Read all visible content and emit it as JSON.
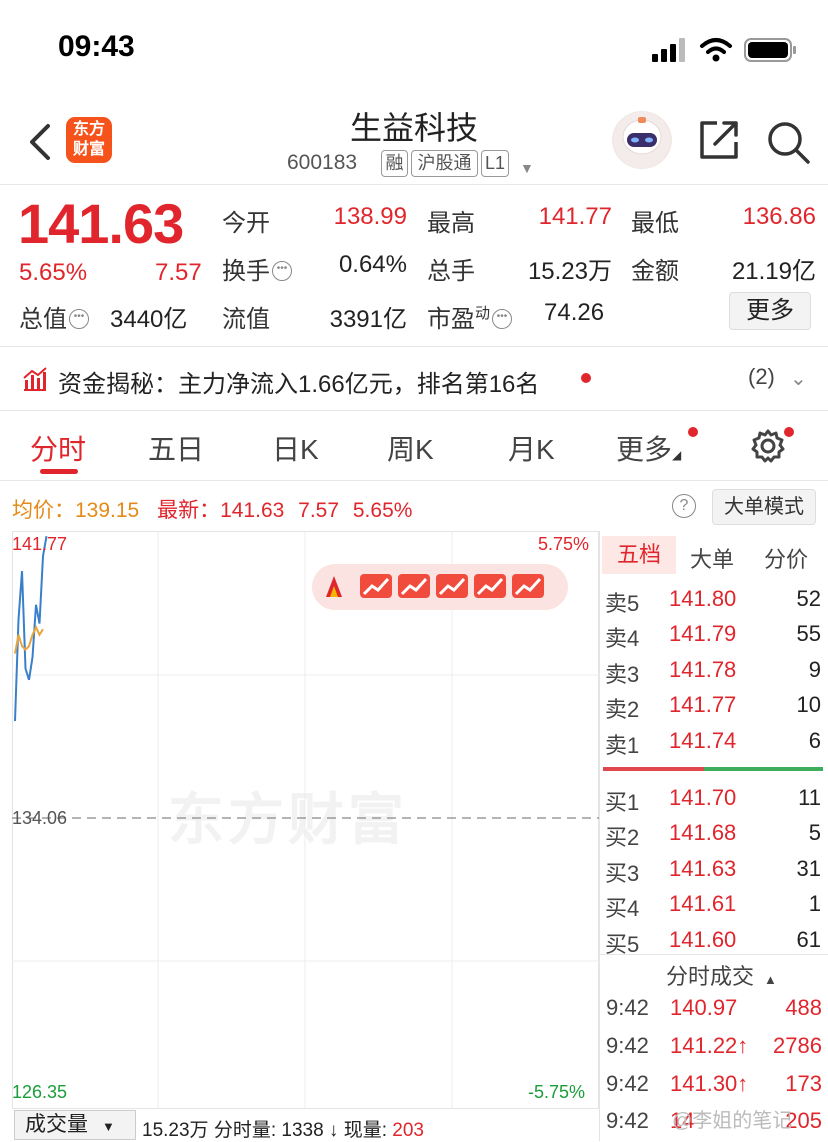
{
  "status_bar": {
    "time": "09:43"
  },
  "header": {
    "brand_line1": "东方",
    "brand_line2": "财富",
    "stock_name": "生益科技",
    "stock_code": "600183",
    "tags": [
      "融",
      "沪股通",
      "L1"
    ]
  },
  "quote": {
    "price": "141.63",
    "change_pct": "5.65%",
    "change_abs": "7.57",
    "market_cap_label": "总值",
    "market_cap": "3440亿",
    "fields": [
      {
        "label": "今开",
        "value": "138.99",
        "color": "red"
      },
      {
        "label": "最高",
        "value": "141.77",
        "color": "red"
      },
      {
        "label": "最低",
        "value": "136.86",
        "color": "red"
      },
      {
        "label": "换手",
        "value": "0.64%",
        "color": "dark"
      },
      {
        "label": "总手",
        "value": "15.23万",
        "color": "dark"
      },
      {
        "label": "金额",
        "value": "21.19亿",
        "color": "dark"
      },
      {
        "label": "流值",
        "value": "3391亿",
        "color": "dark"
      },
      {
        "label": "市盈",
        "sup": "动",
        "value": "74.26",
        "color": "dark"
      }
    ],
    "more_button": "更多"
  },
  "fund_flow": {
    "text": "资金揭秘：主力净流入1.66亿元，排名第16名",
    "count": "(2)"
  },
  "tabs": [
    "分时",
    "五日",
    "日K",
    "周K",
    "月K",
    "更多"
  ],
  "chart_header": {
    "avg_label": "均价：",
    "avg_value": "139.15",
    "latest_label": "最新：",
    "latest_price": "141.63",
    "latest_change": "7.57",
    "latest_pct": "5.65%",
    "mode_button": "大单模式"
  },
  "chart_labels": {
    "top_price": "141.77",
    "mid_price": "134.06",
    "bottom_price": "126.35",
    "top_pct": "5.75%",
    "bottom_pct": "-5.75%",
    "watermark": "东方财富"
  },
  "chart_data": {
    "type": "line",
    "title": "",
    "ylim": [
      126.35,
      141.77
    ],
    "prev_close": 134.06,
    "series": [
      {
        "values": [
          136.7,
          139.4,
          140.7,
          138.1,
          137.8,
          138.4,
          139.8,
          139.3,
          141.1,
          141.63
        ]
      },
      {
        "values": [
          138.5,
          139.0,
          138.7,
          138.6,
          138.7,
          139.0,
          139.2,
          139.0,
          139.15
        ]
      }
    ],
    "grid": true
  },
  "order_book": {
    "tabs": [
      "五档",
      "大单",
      "分价"
    ],
    "asks": [
      {
        "label": "卖5",
        "price": "141.80",
        "vol": "52"
      },
      {
        "label": "卖4",
        "price": "141.79",
        "vol": "55"
      },
      {
        "label": "卖3",
        "price": "141.78",
        "vol": "9"
      },
      {
        "label": "卖2",
        "price": "141.77",
        "vol": "10"
      },
      {
        "label": "卖1",
        "price": "141.74",
        "vol": "6"
      }
    ],
    "bids": [
      {
        "label": "买1",
        "price": "141.70",
        "vol": "11"
      },
      {
        "label": "买2",
        "price": "141.68",
        "vol": "5"
      },
      {
        "label": "买3",
        "price": "141.63",
        "vol": "31"
      },
      {
        "label": "买4",
        "price": "141.61",
        "vol": "1"
      },
      {
        "label": "买5",
        "price": "141.60",
        "vol": "61"
      }
    ],
    "ticks_title": "分时成交",
    "ticks": [
      {
        "time": "9:42",
        "price": "140.97",
        "vol": "488"
      },
      {
        "time": "9:42",
        "price": "141.22↑",
        "vol": "2786"
      },
      {
        "time": "9:42",
        "price": "141.30↑",
        "vol": "173"
      },
      {
        "time": "9:42",
        "price": "14",
        "vol": "205"
      }
    ]
  },
  "bottom": {
    "volume_select": "成交量",
    "volume_info": "15.23万 分时量: 1338 ↓ 现量: ",
    "current_volume": "203",
    "watermark": "@李姐的笔记"
  }
}
